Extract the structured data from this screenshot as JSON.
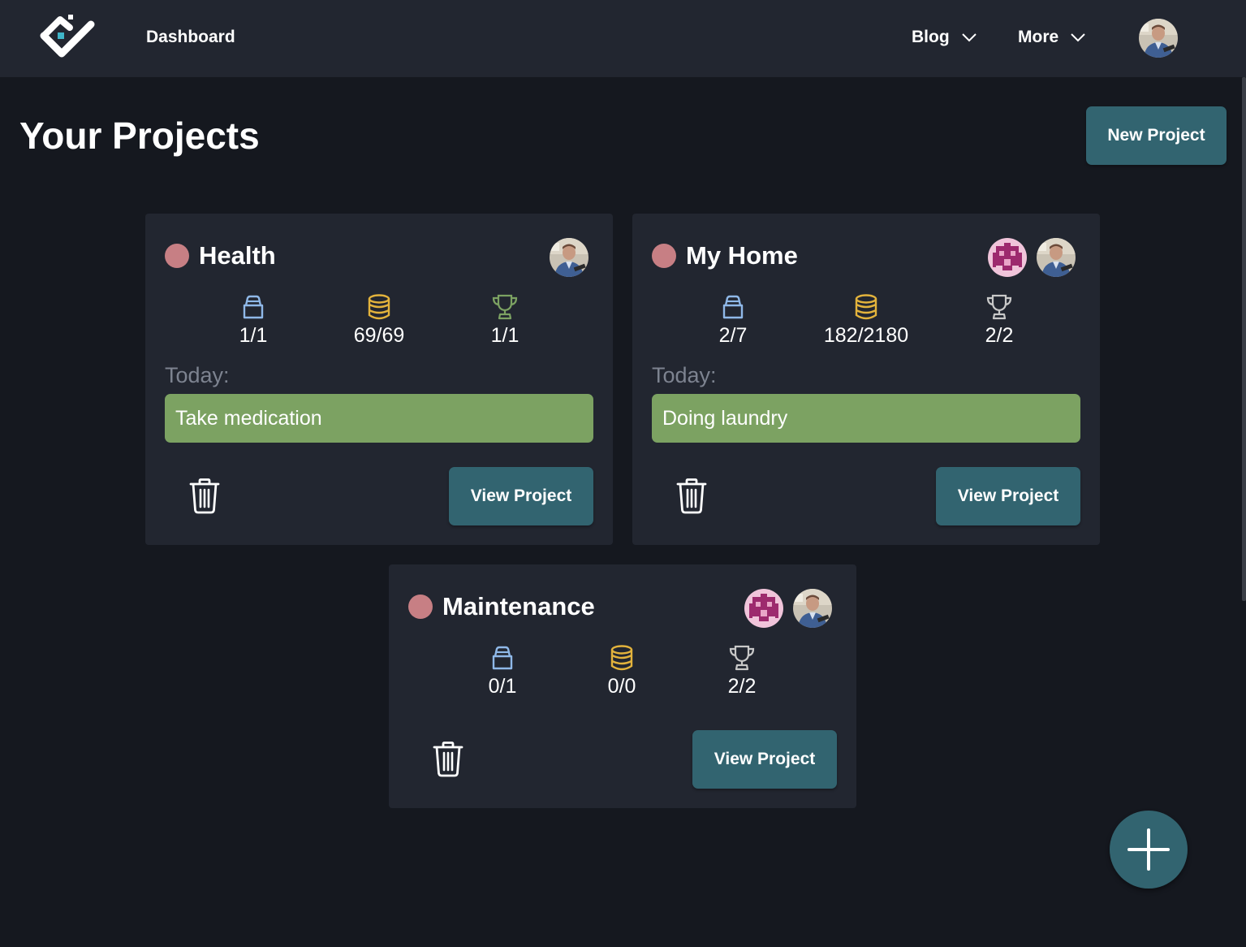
{
  "header": {
    "dashboard_label": "Dashboard",
    "menus": [
      {
        "label": "Blog"
      },
      {
        "label": "More"
      }
    ]
  },
  "page": {
    "title": "Your Projects",
    "new_project_label": "New Project"
  },
  "projects": [
    {
      "name": "Health",
      "stats": {
        "tasks": "1/1",
        "coins": "69/69",
        "trophies": "1/1"
      },
      "trophy_color": "#7ca262",
      "today_label": "Today:",
      "today_task": "Take medication",
      "view_label": "View Project",
      "members": [
        "user-photo"
      ]
    },
    {
      "name": "My Home",
      "stats": {
        "tasks": "2/7",
        "coins": "182/2180",
        "trophies": "2/2"
      },
      "trophy_color": "#c8c8c8",
      "today_label": "Today:",
      "today_task": "Doing laundry",
      "view_label": "View Project",
      "members": [
        "pixel-avatar",
        "user-photo"
      ]
    },
    {
      "name": "Maintenance",
      "stats": {
        "tasks": "0/1",
        "coins": "0/0",
        "trophies": "2/2"
      },
      "trophy_color": "#c8c8c8",
      "view_label": "View Project",
      "members": [
        "pixel-avatar",
        "user-photo"
      ]
    }
  ],
  "colors": {
    "background": "#15181f",
    "card": "#222630",
    "accent_button": "#326470",
    "status_dot": "#c77f84",
    "today_task": "#7ca262",
    "task_icon": "#8fb8e8",
    "coin_icon": "#e3b33c"
  }
}
